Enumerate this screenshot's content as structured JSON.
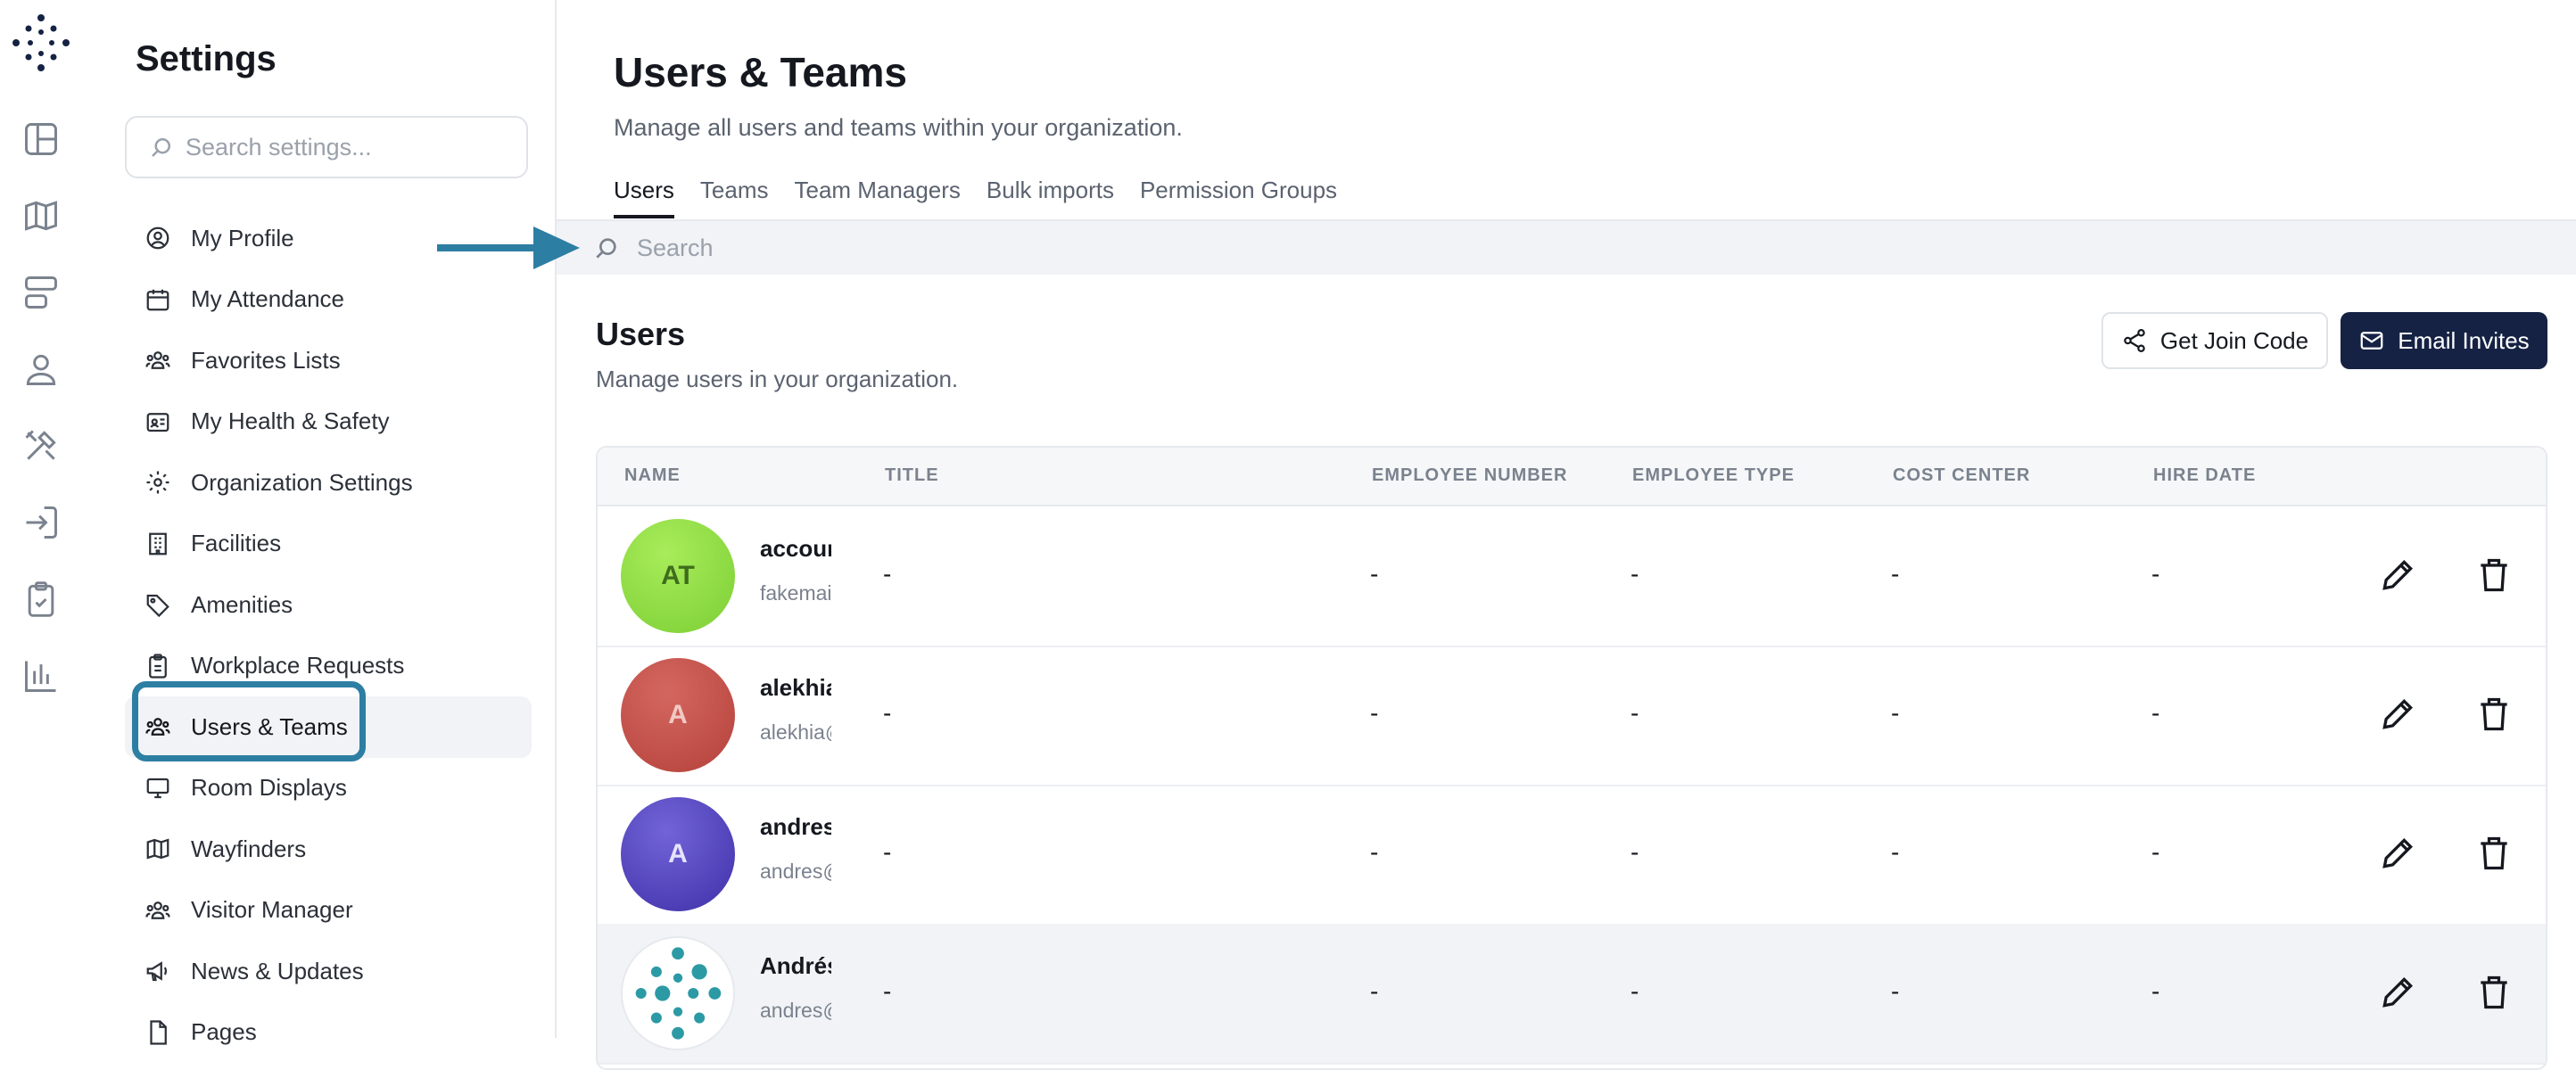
{
  "rail": {
    "icons": [
      "logo-icon",
      "dashboard-icon",
      "map-icon",
      "layout-icon",
      "user-icon",
      "tools-icon",
      "sign-in-icon",
      "clipboard-check-icon",
      "bar-chart-icon"
    ]
  },
  "settings": {
    "title": "Settings",
    "search_placeholder": "Search settings...",
    "items": [
      {
        "label": "My Profile",
        "icon": "user-circle-icon"
      },
      {
        "label": "My Attendance",
        "icon": "calendar-icon"
      },
      {
        "label": "Favorites Lists",
        "icon": "users-group-icon"
      },
      {
        "label": "My Health & Safety",
        "icon": "id-card-icon"
      },
      {
        "label": "Organization Settings",
        "icon": "gear-icon"
      },
      {
        "label": "Facilities",
        "icon": "building-icon"
      },
      {
        "label": "Amenities",
        "icon": "tag-icon"
      },
      {
        "label": "Workplace Requests",
        "icon": "clipboard-icon"
      },
      {
        "label": "Users & Teams",
        "icon": "users-group-icon",
        "active": true
      },
      {
        "label": "Room Displays",
        "icon": "monitor-icon"
      },
      {
        "label": "Wayfinders",
        "icon": "map-icon"
      },
      {
        "label": "Visitor Manager",
        "icon": "users-group-icon"
      },
      {
        "label": "News & Updates",
        "icon": "megaphone-icon"
      },
      {
        "label": "Pages",
        "icon": "file-icon"
      }
    ]
  },
  "main": {
    "title": "Users & Teams",
    "subtitle": "Manage all users and teams within your organization.",
    "tabs": [
      "Users",
      "Teams",
      "Team Managers",
      "Bulk imports",
      "Permission Groups"
    ],
    "active_tab": "Users",
    "search_placeholder": "Search"
  },
  "users_section": {
    "title": "Users",
    "subtitle": "Manage users in your organization.",
    "join_code_label": "Get Join Code",
    "email_invites_label": "Email Invites"
  },
  "table": {
    "headers": [
      "NAME",
      "TITLE",
      "EMPLOYEE NUMBER",
      "EMPLOYEE TYPE",
      "COST CENTER",
      "HIRE DATE"
    ],
    "rows": [
      {
        "initials": "AT",
        "name": "accour",
        "email": "fakemai",
        "title": "-",
        "employee_number": "-",
        "employee_type": "-",
        "cost_center": "-",
        "hire_date": "-",
        "avatar_color": "#8fdc3f",
        "avatar_text_color": "#3f6d1c"
      },
      {
        "initials": "A",
        "name": "alekhia",
        "email": "alekhia@",
        "title": "-",
        "employee_number": "-",
        "employee_type": "-",
        "cost_center": "-",
        "hire_date": "-",
        "avatar_color": "#bf4a45",
        "avatar_text_color": "#f2c9c4"
      },
      {
        "initials": "A",
        "name": "andres",
        "email": "andres@",
        "title": "-",
        "employee_number": "-",
        "employee_type": "-",
        "cost_center": "-",
        "hire_date": "-",
        "avatar_color": "#5444c2",
        "avatar_text_color": "#e6e3ff"
      },
      {
        "initials": "",
        "name": "Andrés",
        "email": "andres@",
        "title": "-",
        "employee_number": "-",
        "employee_type": "-",
        "cost_center": "-",
        "hire_date": "-",
        "avatar_color": "#ffffff",
        "avatar_text_color": "#2b9aa5"
      }
    ]
  },
  "colors": {
    "accent_dark": "#152244",
    "highlight": "#2d7ea3",
    "arrow": "#2d7ea3"
  }
}
